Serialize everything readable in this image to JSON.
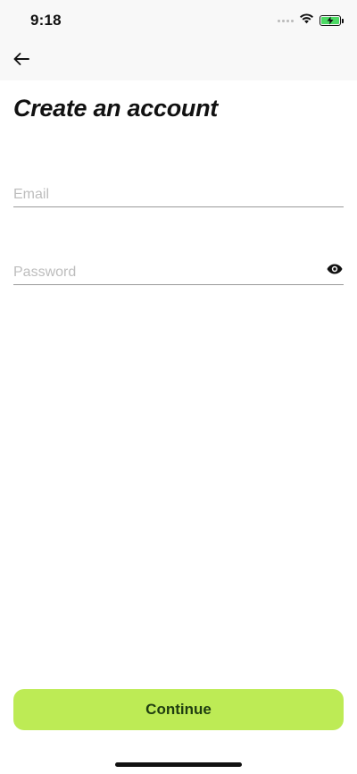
{
  "status_bar": {
    "time": "9:18",
    "signal_icon": "cellular-dots-icon",
    "wifi_icon": "wifi-icon",
    "battery_icon": "battery-charging-icon",
    "battery_level": 1.0
  },
  "nav": {
    "back_icon": "arrow-left-icon"
  },
  "page": {
    "title": "Create an account"
  },
  "form": {
    "email": {
      "value": "",
      "placeholder": "Email"
    },
    "password": {
      "value": "",
      "placeholder": "Password",
      "toggle_icon": "eye-icon"
    }
  },
  "actions": {
    "continue_label": "Continue"
  },
  "colors": {
    "accent": "#bdeb55",
    "accent_text": "#1f3d10",
    "battery": "#4cd964",
    "placeholder": "#bdbdbd",
    "divider": "#9a9a9a"
  }
}
